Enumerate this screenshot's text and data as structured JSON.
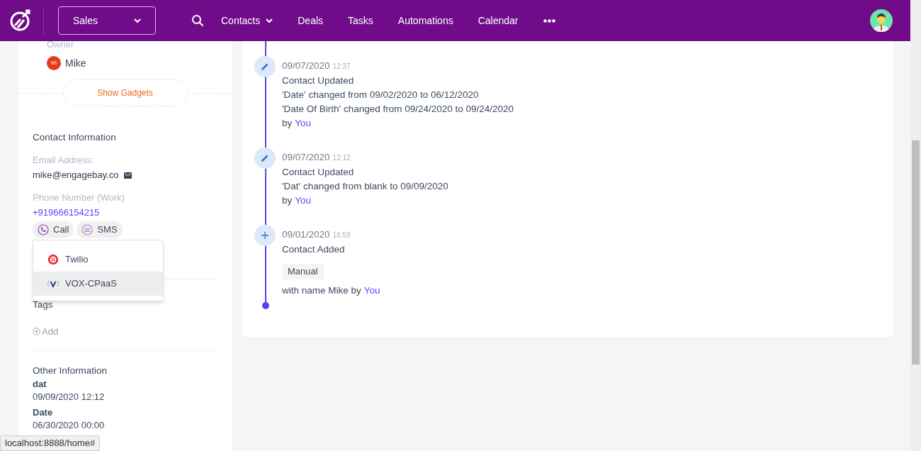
{
  "nav": {
    "pipeline": "Sales",
    "items": [
      {
        "label": "Contacts",
        "has_menu": true
      },
      {
        "label": "Deals",
        "has_menu": false
      },
      {
        "label": "Tasks",
        "has_menu": false
      },
      {
        "label": "Automations",
        "has_menu": false
      },
      {
        "label": "Calendar",
        "has_menu": false
      }
    ]
  },
  "sidebar": {
    "owner_label": "Owner",
    "owner_initials": "MI",
    "owner_name": "Mike",
    "gadgets_button": "Show Gadgets",
    "contact_title": "Contact Information",
    "email_label": "Email Address:",
    "email": "mike@engagebay.co",
    "phone_label": "Phone Number (Work)",
    "phone": "+919666154215",
    "actions": [
      {
        "kind": "call",
        "label": "Call"
      },
      {
        "kind": "sms",
        "label": "SMS"
      }
    ],
    "menu": [
      {
        "kind": "twilio",
        "label": "Twilio",
        "highlighted": false
      },
      {
        "kind": "vox",
        "label": "VOX-CPaaS",
        "highlighted": true
      }
    ],
    "tags_title": "Tags",
    "add_tag": "Add",
    "other_title": "Other Information",
    "fields": [
      {
        "label": "dat",
        "value": "09/09/2020 12:12"
      },
      {
        "label": "Date",
        "value": "06/30/2020 00:00"
      }
    ]
  },
  "timeline": [
    {
      "kind": "update",
      "date": "09/07/2020",
      "time": "12:37",
      "title": "Contact Updated",
      "lines": [
        "'Date' changed from 09/02/2020 to 06/12/2020",
        "'Date Of Birth' changed from 09/24/2020 to 09/24/2020"
      ],
      "by_text": "by",
      "by_link": "You"
    },
    {
      "kind": "update",
      "date": "09/07/2020",
      "time": "12:12",
      "title": "Contact Updated",
      "lines": [
        "'Dat' changed from blank to 09/09/2020"
      ],
      "by_text": "by",
      "by_link": "You"
    },
    {
      "kind": "add",
      "date": "09/01/2020",
      "time": "16:59",
      "title": "Contact Added",
      "tag": "Manual",
      "by_text": "with name Mike by",
      "by_link": "You"
    }
  ],
  "status_bar": "localhost:8888/home#"
}
